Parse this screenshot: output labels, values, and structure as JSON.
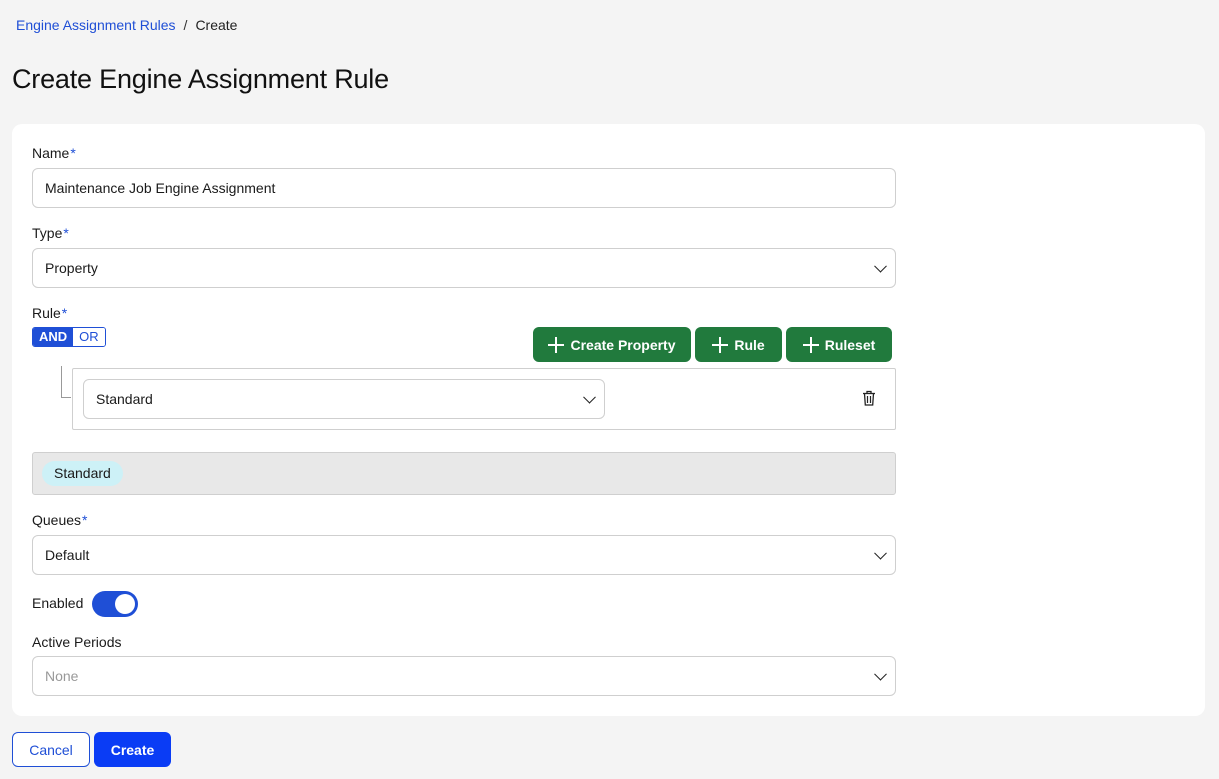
{
  "breadcrumb": {
    "parent": "Engine Assignment Rules",
    "separator": "/",
    "current": "Create"
  },
  "page_title": "Create Engine Assignment Rule",
  "form": {
    "name": {
      "label": "Name",
      "required_mark": "*",
      "value": "Maintenance Job Engine Assignment"
    },
    "type": {
      "label": "Type",
      "required_mark": "*",
      "value": "Property"
    },
    "rule": {
      "label": "Rule",
      "required_mark": "*",
      "combinator": {
        "and_label": "AND",
        "or_label": "OR",
        "selected": "AND"
      },
      "buttons": {
        "create_property": "Create Property",
        "add_rule": "Rule",
        "add_ruleset": "Ruleset"
      },
      "conditions": [
        {
          "value": "Standard"
        }
      ],
      "preview_chips": [
        "Standard"
      ]
    },
    "queues": {
      "label": "Queues",
      "required_mark": "*",
      "value": "Default"
    },
    "enabled": {
      "label": "Enabled",
      "on": true
    },
    "active_periods": {
      "label": "Active Periods",
      "placeholder": "None"
    }
  },
  "actions": {
    "cancel": "Cancel",
    "create": "Create"
  },
  "colors": {
    "accent": "#1f4fd6",
    "primary_button": "#0a3cf5",
    "green_button": "#217a3d",
    "chip": "#cdf1f7"
  }
}
